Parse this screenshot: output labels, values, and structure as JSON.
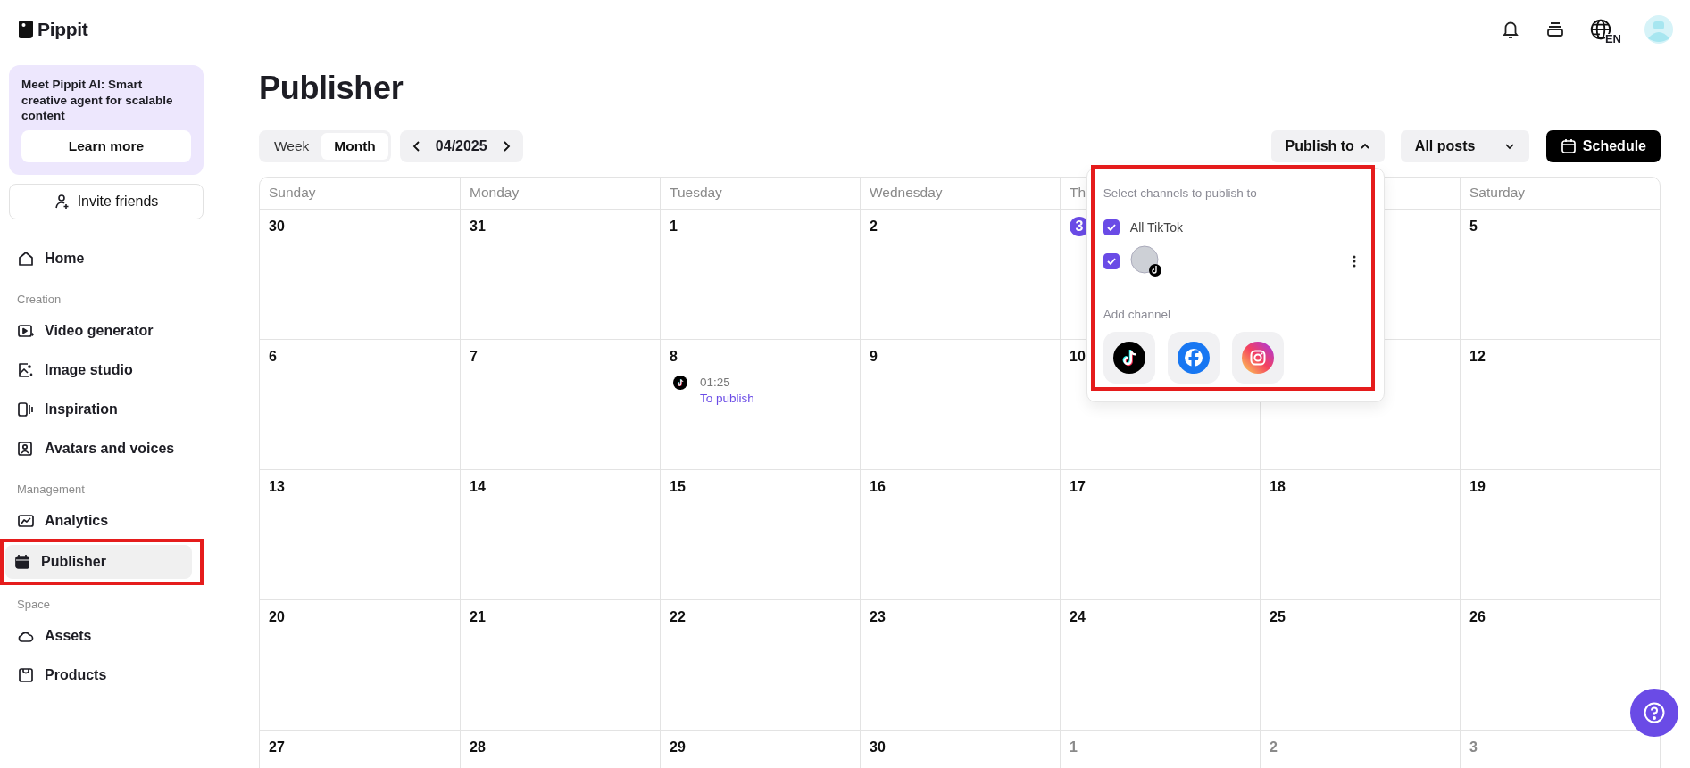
{
  "brand": {
    "name": "Pippit"
  },
  "promo": {
    "text": "Meet Pippit AI: Smart creative agent for scalable content",
    "button": "Learn more"
  },
  "invite": {
    "label": "Invite friends"
  },
  "nav": [
    {
      "kind": "item",
      "label": "Home",
      "selected": false,
      "highlighted": false
    },
    {
      "kind": "section",
      "label": "Creation"
    },
    {
      "kind": "item",
      "label": "Video generator",
      "selected": false,
      "highlighted": false
    },
    {
      "kind": "item",
      "label": "Image studio",
      "selected": false,
      "highlighted": false
    },
    {
      "kind": "item",
      "label": "Inspiration",
      "selected": false,
      "highlighted": false
    },
    {
      "kind": "item",
      "label": "Avatars and voices",
      "selected": false,
      "highlighted": false
    },
    {
      "kind": "section",
      "label": "Management"
    },
    {
      "kind": "item",
      "label": "Analytics",
      "selected": false,
      "highlighted": false
    },
    {
      "kind": "item",
      "label": "Publisher",
      "selected": true,
      "highlighted": true
    },
    {
      "kind": "section",
      "label": "Space"
    },
    {
      "kind": "item",
      "label": "Assets",
      "selected": false,
      "highlighted": false
    },
    {
      "kind": "item",
      "label": "Products",
      "selected": false,
      "highlighted": false
    }
  ],
  "header": {
    "language": "EN"
  },
  "page_title": "Publisher",
  "view_tabs": [
    {
      "label": "Week",
      "selected": false
    },
    {
      "label": "Month",
      "selected": true
    }
  ],
  "period": "04/2025",
  "publish_to": {
    "label": "Publish to",
    "expanded": true
  },
  "filter": {
    "value": "All posts"
  },
  "schedule_button": "Schedule",
  "popup": {
    "title": "Select channels to publish to",
    "highlighted": true,
    "channels": [
      {
        "kind": "group",
        "label": "All TikTok",
        "checked": true
      },
      {
        "kind": "account",
        "checked": true
      }
    ],
    "add_label": "Add channel",
    "add_channels": [
      {
        "kind": "tiktok"
      },
      {
        "kind": "facebook"
      },
      {
        "kind": "instagram"
      }
    ]
  },
  "calendar": {
    "weekdays": [
      {
        "label": "Sunday"
      },
      {
        "label": "Monday"
      },
      {
        "label": "Tuesday"
      },
      {
        "label": "Wednesday"
      },
      {
        "label": "Th"
      },
      {
        "covered": true
      },
      {
        "label": "Saturday"
      }
    ],
    "weeks": [
      [
        {
          "day": "30",
          "muted": false
        },
        {
          "day": "31",
          "muted": false
        },
        {
          "day": "1",
          "muted": false
        },
        {
          "day": "2",
          "muted": false
        },
        {
          "day": "3",
          "muted": false,
          "today": true
        },
        {
          "covered": true
        },
        {
          "day": "5",
          "muted": false
        }
      ],
      [
        {
          "day": "6",
          "muted": false
        },
        {
          "day": "7",
          "muted": false
        },
        {
          "day": "8",
          "muted": false,
          "events": [
            {
              "time": "01:25",
              "status": "To publish"
            }
          ]
        },
        {
          "day": "9",
          "muted": false
        },
        {
          "day": "10",
          "muted": false
        },
        {
          "covered": true
        },
        {
          "day": "12",
          "muted": false
        }
      ],
      [
        {
          "day": "13",
          "muted": false
        },
        {
          "day": "14",
          "muted": false
        },
        {
          "day": "15",
          "muted": false
        },
        {
          "day": "16",
          "muted": false
        },
        {
          "day": "17",
          "muted": false
        },
        {
          "day": "18",
          "muted": false
        },
        {
          "day": "19",
          "muted": false
        }
      ],
      [
        {
          "day": "20",
          "muted": false
        },
        {
          "day": "21",
          "muted": false
        },
        {
          "day": "22",
          "muted": false
        },
        {
          "day": "23",
          "muted": false
        },
        {
          "day": "24",
          "muted": false
        },
        {
          "day": "25",
          "muted": false
        },
        {
          "day": "26",
          "muted": false
        }
      ],
      [
        {
          "day": "27",
          "muted": false
        },
        {
          "day": "28",
          "muted": false
        },
        {
          "day": "29",
          "muted": false
        },
        {
          "day": "30",
          "muted": false
        },
        {
          "day": "1",
          "muted": true
        },
        {
          "day": "2",
          "muted": true
        },
        {
          "day": "3",
          "muted": true
        }
      ]
    ]
  }
}
